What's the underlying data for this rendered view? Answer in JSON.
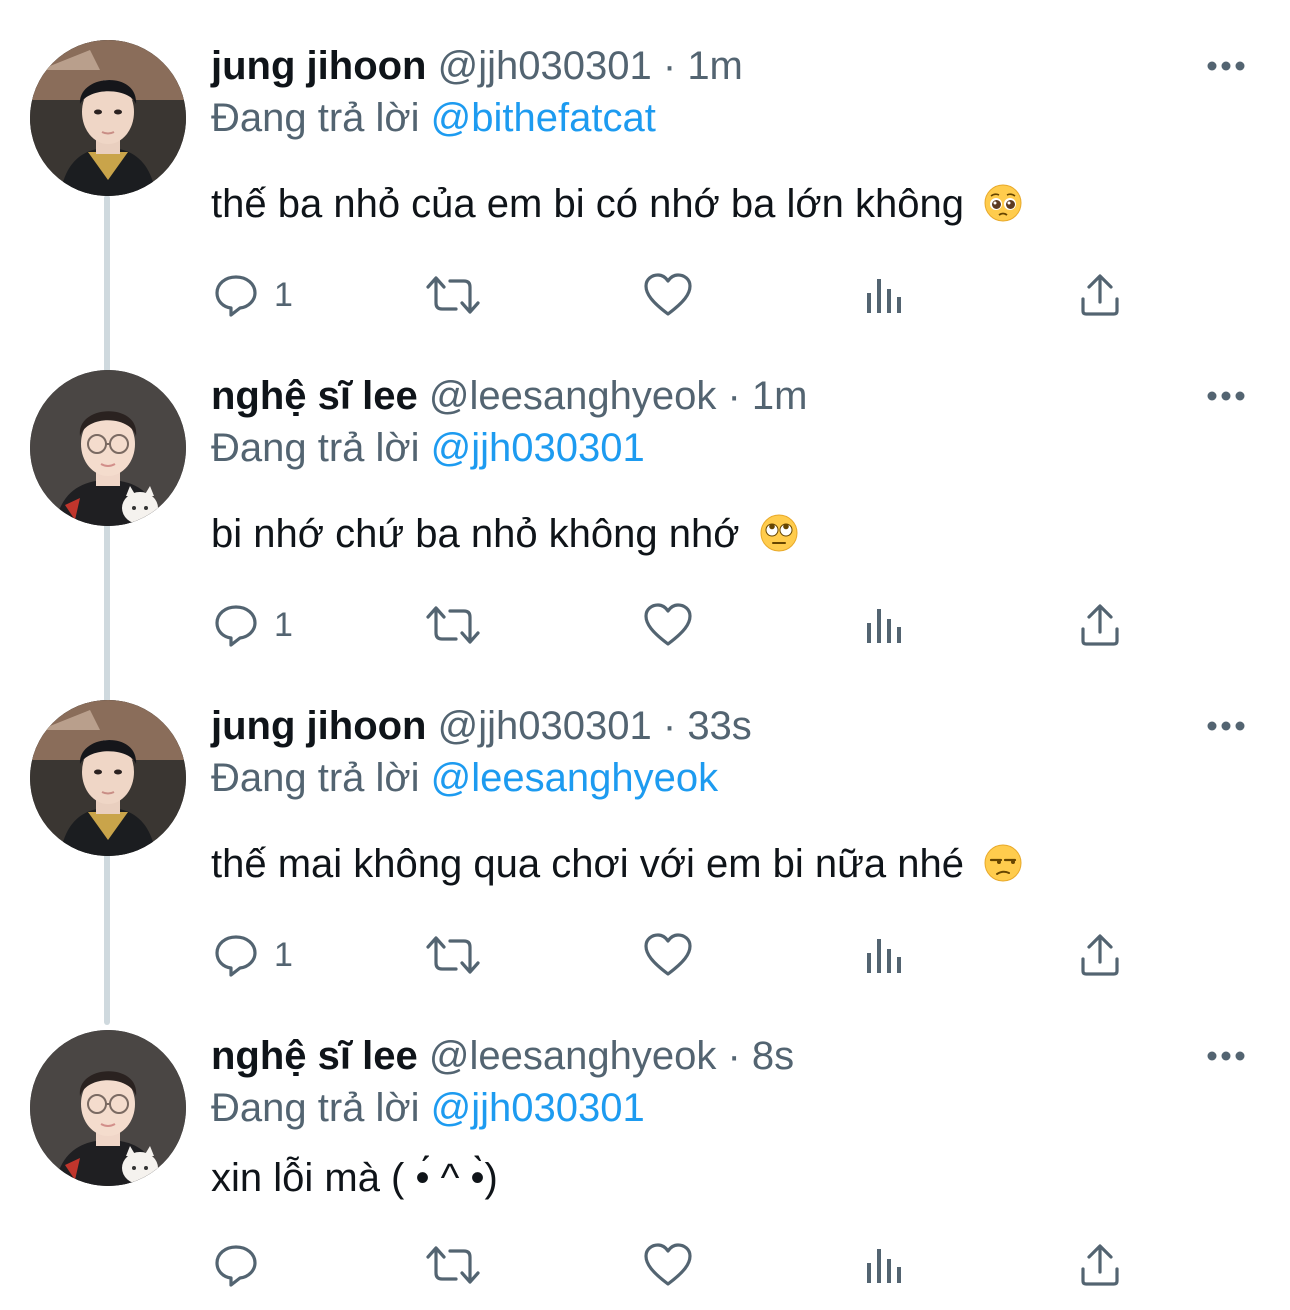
{
  "reply_prefix": "Đang trả lời",
  "tweets": [
    {
      "name": "jung jihoon",
      "handle": "@jjh030301",
      "separator": "·",
      "time": "1m",
      "reply_to": "@bithefatcat",
      "text": "thế ba nhỏ của em bi có nhớ ba lớn không",
      "emoji": "pleading-face",
      "reply_count": "1",
      "avatar": "jung-jihoon-avatar"
    },
    {
      "name": "nghệ sĩ lee",
      "handle": "@leesanghyeok",
      "separator": "·",
      "time": "1m",
      "reply_to": "@jjh030301",
      "text": "bi nhớ chứ ba nhỏ không nhớ",
      "emoji": "eye-roll-face",
      "reply_count": "1",
      "avatar": "nghe-si-lee-avatar"
    },
    {
      "name": "jung jihoon",
      "handle": "@jjh030301",
      "separator": "·",
      "time": "33s",
      "reply_to": "@leesanghyeok",
      "text": "thế mai không qua chơi với em bi nữa nhé",
      "emoji": "unamused-face",
      "reply_count": "1",
      "avatar": "jung-jihoon-avatar"
    },
    {
      "name": "nghệ sĩ lee",
      "handle": "@leesanghyeok",
      "separator": "·",
      "time": "8s",
      "reply_to": "@jjh030301",
      "text": "xin lỗi mà ( •́ ^ •̀)",
      "emoji": "",
      "reply_count": "",
      "avatar": "nghe-si-lee-avatar"
    }
  ],
  "colors": {
    "text": "#0f1419",
    "secondary": "#536471",
    "accent": "#1d9bf0",
    "thread_line": "#cfd9de"
  },
  "icons": [
    "more-icon",
    "reply-icon",
    "retweet-icon",
    "like-icon",
    "analytics-icon",
    "share-icon"
  ]
}
